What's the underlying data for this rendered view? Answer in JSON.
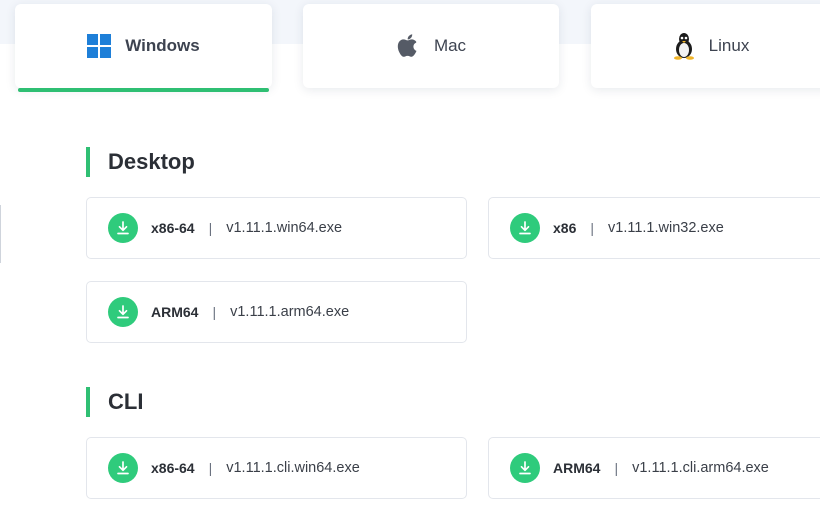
{
  "os_tabs": [
    {
      "label": "Windows",
      "icon": "windows-icon",
      "active": true
    },
    {
      "label": "Mac",
      "icon": "apple-icon",
      "active": false
    },
    {
      "label": "Linux",
      "icon": "tux-penguin-icon",
      "active": false
    }
  ],
  "colors": {
    "accent": "#2fbf73",
    "download_icon": "#2fcb7c",
    "windows_blue": "#1e7fd8"
  },
  "sections": [
    {
      "title": "Desktop",
      "downloads": [
        {
          "arch": "x86-64",
          "separator": "|",
          "file": "v1.11.1.win64.exe"
        },
        {
          "arch": "x86",
          "separator": "|",
          "file": "v1.11.1.win32.exe"
        },
        {
          "arch": "ARM64",
          "separator": "|",
          "file": "v1.11.1.arm64.exe"
        }
      ]
    },
    {
      "title": "CLI",
      "downloads": [
        {
          "arch": "x86-64",
          "separator": "|",
          "file": "v1.11.1.cli.win64.exe"
        },
        {
          "arch": "ARM64",
          "separator": "|",
          "file": "v1.11.1.cli.arm64.exe"
        }
      ]
    }
  ]
}
